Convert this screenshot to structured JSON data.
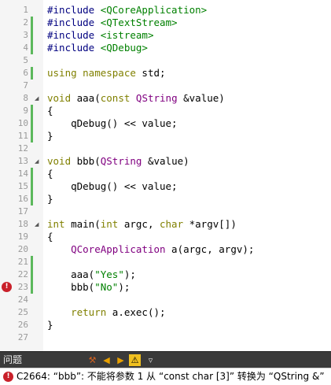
{
  "code_lines": [
    {
      "num": "1",
      "tokens": [
        [
          "pp",
          "#include "
        ],
        [
          "inc",
          "<QCoreApplication>"
        ]
      ]
    },
    {
      "num": "2",
      "tokens": [
        [
          "pp",
          "#include "
        ],
        [
          "inc",
          "<QTextStream>"
        ]
      ]
    },
    {
      "num": "3",
      "tokens": [
        [
          "pp",
          "#include "
        ],
        [
          "inc",
          "<istream>"
        ]
      ]
    },
    {
      "num": "4",
      "tokens": [
        [
          "pp",
          "#include "
        ],
        [
          "inc",
          "<QDebug>"
        ]
      ]
    },
    {
      "num": "5",
      "tokens": []
    },
    {
      "num": "6",
      "tokens": [
        [
          "kw",
          "using namespace"
        ],
        [
          "",
          " std;"
        ]
      ]
    },
    {
      "num": "7",
      "tokens": []
    },
    {
      "num": "8",
      "tokens": [
        [
          "kw",
          "void"
        ],
        [
          "",
          " aaa("
        ],
        [
          "kw",
          "const"
        ],
        [
          "",
          " "
        ],
        [
          "ty",
          "QString"
        ],
        [
          "",
          " &value)"
        ]
      ]
    },
    {
      "num": "9",
      "tokens": [
        [
          "",
          "{"
        ]
      ]
    },
    {
      "num": "10",
      "tokens": [
        [
          "",
          "    qDebug() << value;"
        ]
      ]
    },
    {
      "num": "11",
      "tokens": [
        [
          "",
          "}"
        ]
      ]
    },
    {
      "num": "12",
      "tokens": []
    },
    {
      "num": "13",
      "tokens": [
        [
          "kw",
          "void"
        ],
        [
          "",
          " bbb("
        ],
        [
          "ty",
          "QString"
        ],
        [
          "",
          " &value)"
        ]
      ]
    },
    {
      "num": "14",
      "tokens": [
        [
          "",
          "{"
        ]
      ]
    },
    {
      "num": "15",
      "tokens": [
        [
          "",
          "    qDebug() << value;"
        ]
      ]
    },
    {
      "num": "16",
      "tokens": [
        [
          "",
          "}"
        ]
      ]
    },
    {
      "num": "17",
      "tokens": []
    },
    {
      "num": "18",
      "tokens": [
        [
          "kw",
          "int"
        ],
        [
          "",
          " main("
        ],
        [
          "kw",
          "int"
        ],
        [
          "",
          " argc, "
        ],
        [
          "kw",
          "char"
        ],
        [
          "",
          " *argv[])"
        ]
      ]
    },
    {
      "num": "19",
      "tokens": [
        [
          "",
          "{"
        ]
      ]
    },
    {
      "num": "20",
      "tokens": [
        [
          "",
          "    "
        ],
        [
          "ty",
          "QCoreApplication"
        ],
        [
          "",
          " a(argc, argv);"
        ]
      ]
    },
    {
      "num": "21",
      "tokens": []
    },
    {
      "num": "22",
      "tokens": [
        [
          "",
          "    aaa("
        ],
        [
          "str",
          "\"Yes\""
        ],
        [
          "",
          ");"
        ]
      ]
    },
    {
      "num": "23",
      "tokens": [
        [
          "",
          "    bbb("
        ],
        [
          "str",
          "\"No\""
        ],
        [
          "",
          ");"
        ]
      ]
    },
    {
      "num": "24",
      "tokens": []
    },
    {
      "num": "25",
      "tokens": [
        [
          "",
          "    "
        ],
        [
          "kw",
          "return"
        ],
        [
          "",
          " a.exec();"
        ]
      ]
    },
    {
      "num": "26",
      "tokens": [
        [
          "",
          "}"
        ]
      ]
    },
    {
      "num": "27",
      "tokens": []
    }
  ],
  "changed_lines": [
    "2",
    "3",
    "4",
    "6",
    "9",
    "10",
    "11",
    "14",
    "15",
    "16",
    "21",
    "22",
    "23"
  ],
  "fold_lines": [
    "8",
    "13",
    "18"
  ],
  "error_lines": [
    "23"
  ],
  "issues_panel": {
    "title": "问题",
    "toolbar_icons": [
      "build-error-icon",
      "previous-icon",
      "next-icon",
      "warning-filter-icon",
      "filter-icon"
    ]
  },
  "status": {
    "message": "C2664: “bbb”: 不能将参数 1 从 “const char [3]” 转换为 “QString &”"
  },
  "colors": {
    "preprocessor": "#000080",
    "include_path": "#008000",
    "keyword": "#808000",
    "type": "#800080",
    "string": "#008000",
    "error": "#c9202a",
    "change_marker": "#5cb85c"
  }
}
